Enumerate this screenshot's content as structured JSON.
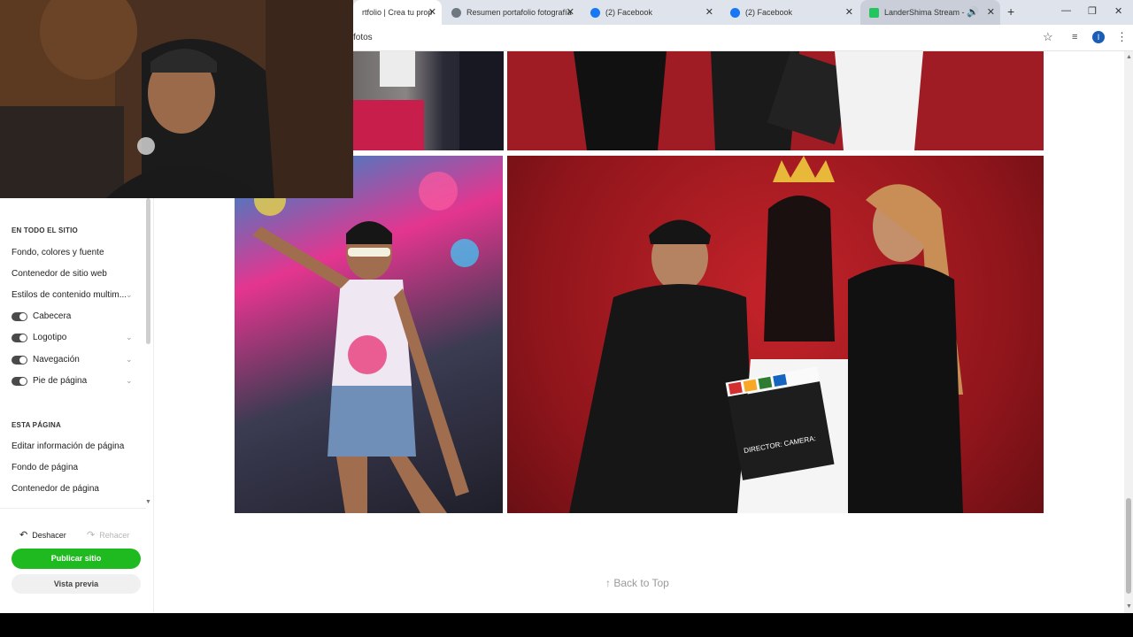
{
  "tabs": [
    {
      "label": "rtfolio | Crea tu prop",
      "active": true,
      "color": "#e35d2b"
    },
    {
      "label": "Resumen portafolio fotografía",
      "active": false,
      "color": "#6f7780"
    },
    {
      "label": "(2) Facebook",
      "active": false,
      "color": "#1877f2"
    },
    {
      "label": "(2) Facebook",
      "active": false,
      "color": "#1877f2"
    },
    {
      "label": "LanderShima Stream - Wat",
      "active": false,
      "color": "#22c55e"
    }
  ],
  "omnibox_text": "fotos",
  "profile_initial": "I",
  "sidebar": {
    "section_site": "EN TODO EL SITIO",
    "items": [
      "Fondo, colores y fuente",
      "Contenedor de sitio web",
      "Estilos de contenido multim..."
    ],
    "toggles": [
      {
        "label": "Cabecera",
        "on": true,
        "chevron": false
      },
      {
        "label": "Logotipo",
        "on": true,
        "chevron": true
      },
      {
        "label": "Navegación",
        "on": true,
        "chevron": true
      },
      {
        "label": "Pie de página",
        "on": true,
        "chevron": true
      }
    ],
    "section_page": "ESTA PÁGINA",
    "page_items": [
      "Editar información de página",
      "Fondo de página",
      "Contenedor de página"
    ],
    "undo": "Deshacer",
    "redo": "Rehacer",
    "publish": "Publicar sitio",
    "preview": "Vista previa"
  },
  "back_to_top": "Back to Top",
  "clapper_text": "DIRECTOR: CAMERA:"
}
